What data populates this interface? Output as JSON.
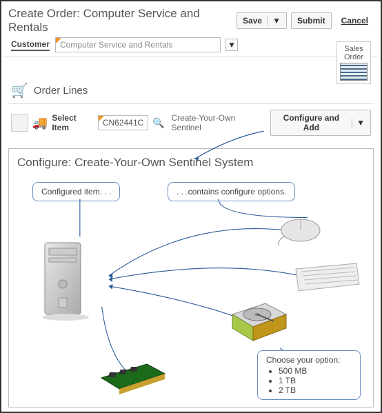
{
  "header": {
    "title": "Create Order: Computer Service and Rentals",
    "save_label": "Save",
    "submit_label": "Submit",
    "cancel_label": "Cancel"
  },
  "customer": {
    "label": "Customer",
    "value": "Computer Service and Rentals"
  },
  "sales_order_badge": {
    "line1": "Sales",
    "line2": "Order"
  },
  "order_lines": {
    "title": "Order Lines",
    "select_item_label": "Select Item",
    "item_value": "CN62441C",
    "item_description": "Create-Your-Own Sentinel",
    "configure_add_label": "Configure and Add"
  },
  "configure_panel": {
    "title": "Configure: Create-Your-Own Sentinel System",
    "callout_configured": "Configured  item. . .",
    "callout_contains": ". . .contains configure  options.",
    "options_callout": {
      "heading": "Choose your option:",
      "opts": [
        "500 MB",
        "1 TB",
        "2 TB"
      ]
    }
  }
}
